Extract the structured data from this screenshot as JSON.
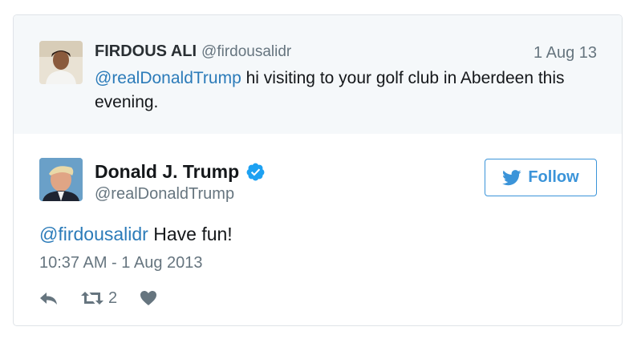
{
  "parent_tweet": {
    "author_name": "FIRDOUS ALI",
    "author_handle": "@firdousalidr",
    "date": "1 Aug 13",
    "mention": "@realDonaldTrump",
    "text": " hi visiting to your golf club in Aberdeen this evening."
  },
  "main_tweet": {
    "author_name": "Donald J. Trump",
    "author_handle": "@realDonaldTrump",
    "verified": true,
    "follow_label": "Follow",
    "mention": "@firdousalidr",
    "text": " Have fun!",
    "timestamp": "10:37 AM - 1 Aug 2013",
    "retweet_count": "2"
  },
  "icons": {
    "reply": "reply-icon",
    "retweet": "retweet-icon",
    "like": "heart-icon",
    "verified": "verified-badge-icon",
    "follow": "twitter-bird-icon"
  },
  "colors": {
    "link": "#2b7bb9",
    "follow_accent": "#3b94d9",
    "verified": "#1da1f2",
    "parent_background": "#f5f8fa",
    "muted": "#66757f",
    "icon": "#8899a6"
  }
}
